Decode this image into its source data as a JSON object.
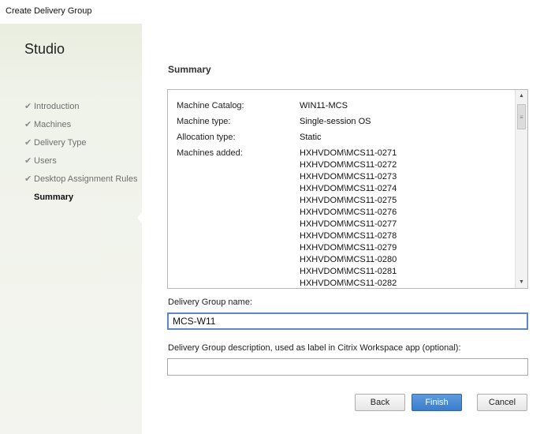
{
  "window": {
    "title": "Create Delivery Group"
  },
  "sidebar": {
    "title": "Studio",
    "steps": [
      {
        "label": "Introduction",
        "done": true
      },
      {
        "label": "Machines",
        "done": true
      },
      {
        "label": "Delivery Type",
        "done": true
      },
      {
        "label": "Users",
        "done": true
      },
      {
        "label": "Desktop Assignment Rules",
        "done": true
      },
      {
        "label": "Summary",
        "done": false,
        "current": true
      }
    ]
  },
  "main": {
    "section_title": "Summary",
    "summary": {
      "machine_catalog_label": "Machine Catalog:",
      "machine_catalog_value": "WIN11-MCS",
      "machine_type_label": "Machine type:",
      "machine_type_value": "Single-session OS",
      "allocation_type_label": "Allocation type:",
      "allocation_type_value": "Static",
      "machines_added_label": "Machines added:",
      "machines_added": [
        "HXHVDOM\\MCS11-0271",
        "HXHVDOM\\MCS11-0272",
        "HXHVDOM\\MCS11-0273",
        "HXHVDOM\\MCS11-0274",
        "HXHVDOM\\MCS11-0275",
        "HXHVDOM\\MCS11-0276",
        "HXHVDOM\\MCS11-0277",
        "HXHVDOM\\MCS11-0278",
        "HXHVDOM\\MCS11-0279",
        "HXHVDOM\\MCS11-0280",
        "HXHVDOM\\MCS11-0281",
        "HXHVDOM\\MCS11-0282"
      ]
    },
    "name_label": "Delivery Group name:",
    "name_value": "MCS-W11",
    "description_label": "Delivery Group description, used as label in Citrix Workspace app (optional):",
    "description_value": ""
  },
  "buttons": {
    "back": "Back",
    "finish": "Finish",
    "cancel": "Cancel"
  },
  "icons": {
    "check": "check-icon",
    "scroll_up": "arrow-up-icon",
    "scroll_down": "arrow-down-icon",
    "scroll_grip": "grip-icon"
  },
  "colors": {
    "primary_button": "#3d7cc9",
    "focus_border": "#5b87c7",
    "sidebar_bg": "#eef1e6"
  }
}
